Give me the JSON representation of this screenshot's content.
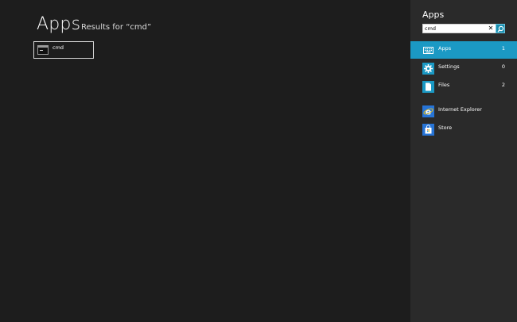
{
  "main": {
    "title": "Apps",
    "results_label": "Results for “cmd”",
    "results": [
      {
        "label": "cmd",
        "icon": "command-prompt-icon"
      }
    ]
  },
  "pane": {
    "title": "Apps",
    "search": {
      "value": "cmd",
      "clear_glyph": "✕"
    },
    "scopes": [
      {
        "label": "Apps",
        "count": "1",
        "icon": "keyboard-icon",
        "selected": true
      },
      {
        "label": "Settings",
        "count": "0",
        "icon": "gear-icon"
      },
      {
        "label": "Files",
        "count": "2",
        "icon": "document-icon"
      }
    ],
    "apps": [
      {
        "label": "Internet Explorer",
        "icon": "internet-explorer-icon"
      },
      {
        "label": "Store",
        "icon": "store-bag-icon"
      }
    ]
  },
  "colors": {
    "background": "#1d1d1d",
    "pane_background": "#2a2a2a",
    "accent": "#1b99c4",
    "app_tile": "#2774d6"
  }
}
